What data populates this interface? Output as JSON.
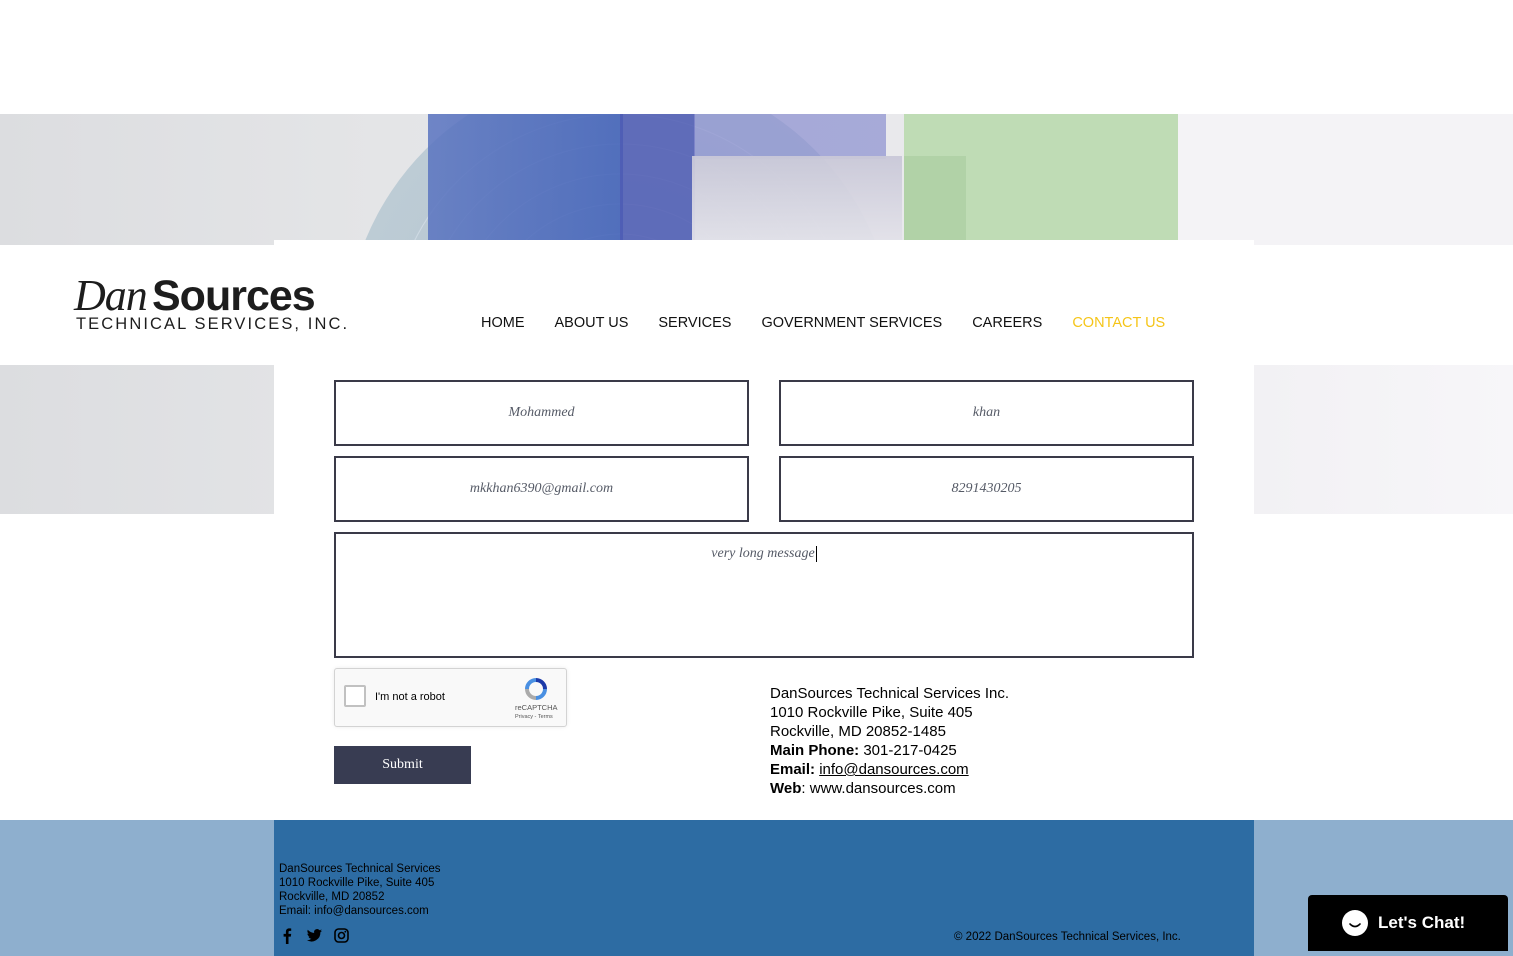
{
  "logo": {
    "part1": "Dan",
    "part2": "Sources",
    "subtitle": "TECHNICAL SERVICES, INC."
  },
  "nav": {
    "items": [
      {
        "label": "HOME"
      },
      {
        "label": "ABOUT US"
      },
      {
        "label": "SERVICES"
      },
      {
        "label": "GOVERNMENT SERVICES"
      },
      {
        "label": "CAREERS"
      },
      {
        "label": "CONTACT US",
        "active": true
      }
    ],
    "active_color": "#f5c518"
  },
  "form": {
    "first_name": "Mohammed",
    "last_name": "khan",
    "email": "mkkhan6390@gmail.com",
    "phone": "8291430205",
    "message": "very long message",
    "captcha_label": "I'm not a robot",
    "captcha_brand": "reCAPTCHA",
    "captcha_terms": "Privacy - Terms",
    "submit_label": "Submit"
  },
  "address": {
    "company": "DanSources Technical Services Inc.",
    "street": "1010 Rockville Pike, Suite 405",
    "city": "Rockville, MD 20852-1485",
    "phone_label": "Main Phone:",
    "phone": " 301-217-0425",
    "email_label": "Email:",
    "email": "info@dansources.com",
    "web_label": "Web",
    "web": ": www.dansources.com"
  },
  "footer": {
    "company": "DanSources Technical Services",
    "street": "1010 Rockville Pike, Suite 405",
    "city": "Rockville, MD 20852",
    "email": "Email: info@dansources.com",
    "copyright": "© 2022 DanSources Technical Services, Inc.",
    "social": [
      "facebook-icon",
      "twitter-icon",
      "instagram-icon"
    ]
  },
  "chat": {
    "label": "Let's Chat!"
  },
  "colors": {
    "footer_outer": "#8eafce",
    "footer_inner": "#2d6ca3",
    "submit": "#383c52"
  }
}
